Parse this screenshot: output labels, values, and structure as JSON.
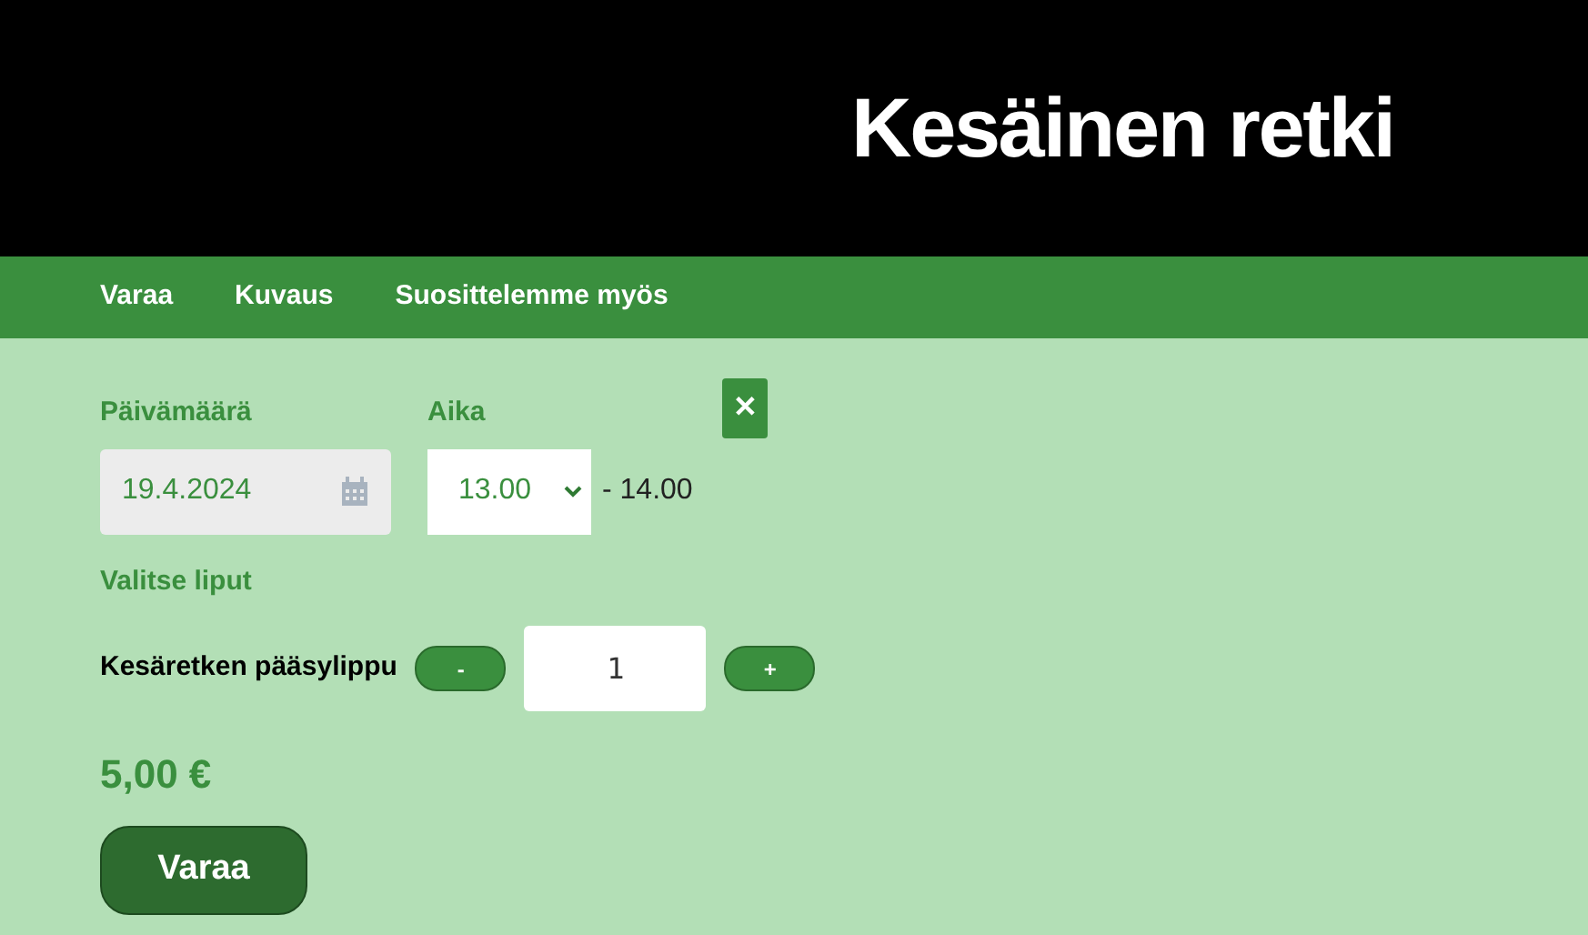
{
  "header": {
    "title": "Kesäinen retki"
  },
  "nav": [
    {
      "label": "Varaa"
    },
    {
      "label": "Kuvaus"
    },
    {
      "label": "Suosittelemme myös"
    }
  ],
  "booking": {
    "date_label": "Päivämäärä",
    "date_value": "19.4.2024",
    "time_label": "Aika",
    "time_value": "13.00",
    "end_time": "- 14.00",
    "close": "✕",
    "tickets_label": "Valitse liput",
    "tickets": [
      {
        "name": "Kesäretken pääsylippu",
        "minus": "-",
        "quantity": "1",
        "plus": "+"
      }
    ],
    "price": "5,00 €",
    "submit": "Varaa"
  }
}
